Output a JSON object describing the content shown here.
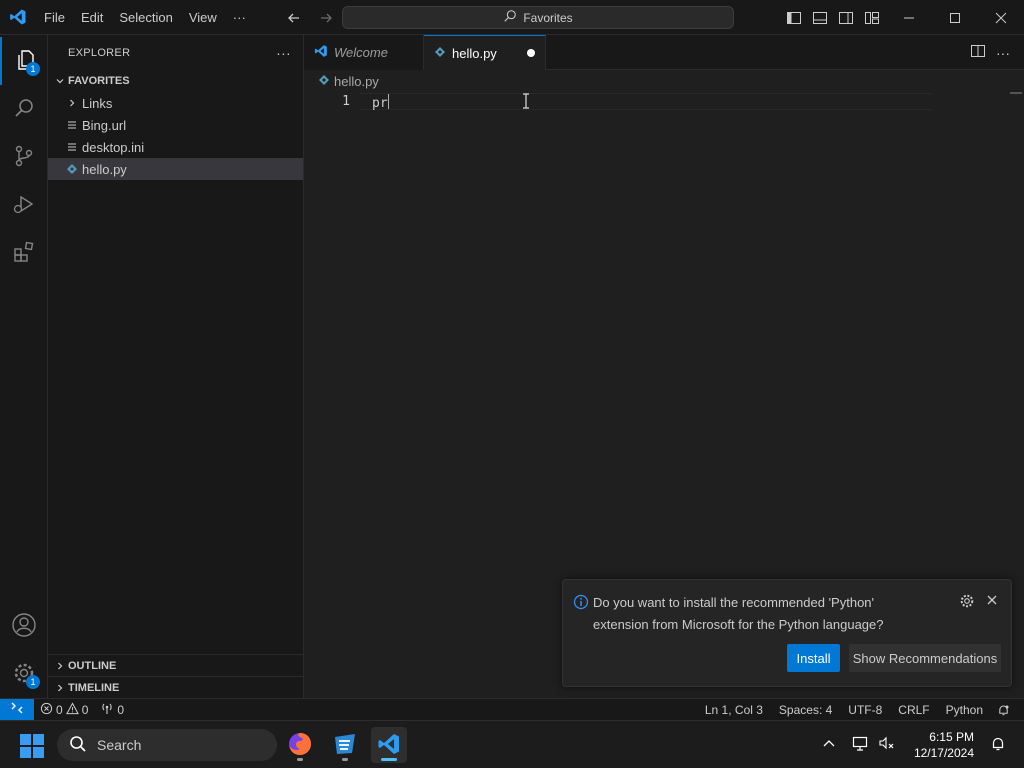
{
  "titlebar": {
    "menu": [
      "File",
      "Edit",
      "Selection",
      "View",
      "···"
    ],
    "command_center": "Favorites"
  },
  "activity_bar": {
    "explorer_badge": "1",
    "settings_badge": "1"
  },
  "sidebar": {
    "title": "EXPLORER",
    "more": "···",
    "section": "FAVORITES",
    "items": [
      {
        "label": "Links",
        "kind": "folder"
      },
      {
        "label": "Bing.url",
        "kind": "file"
      },
      {
        "label": "desktop.ini",
        "kind": "file"
      },
      {
        "label": "hello.py",
        "kind": "python",
        "selected": true
      }
    ],
    "outline": "OUTLINE",
    "timeline": "TIMELINE"
  },
  "tabs": [
    {
      "label": "Welcome",
      "active": false
    },
    {
      "label": "hello.py",
      "active": true,
      "dirty": true
    }
  ],
  "editor": {
    "breadcrumb": "hello.py",
    "line_number": "1",
    "code": "pr"
  },
  "notification": {
    "message": "Do you want to install the recommended 'Python' extension from Microsoft for the Python language?",
    "primary_button": "Install",
    "secondary_button": "Show Recommendations"
  },
  "statusbar": {
    "errors": "0",
    "warnings": "0",
    "ports": "0",
    "position": "Ln 1, Col 3",
    "spaces": "Spaces: 4",
    "encoding": "UTF-8",
    "eol": "CRLF",
    "language": "Python"
  },
  "taskbar": {
    "search_placeholder": "Search",
    "time": "6:15 PM",
    "date": "12/17/2024"
  },
  "colors": {
    "accent": "#0078d4",
    "background": "#1f1f1f",
    "chrome": "#181818"
  }
}
